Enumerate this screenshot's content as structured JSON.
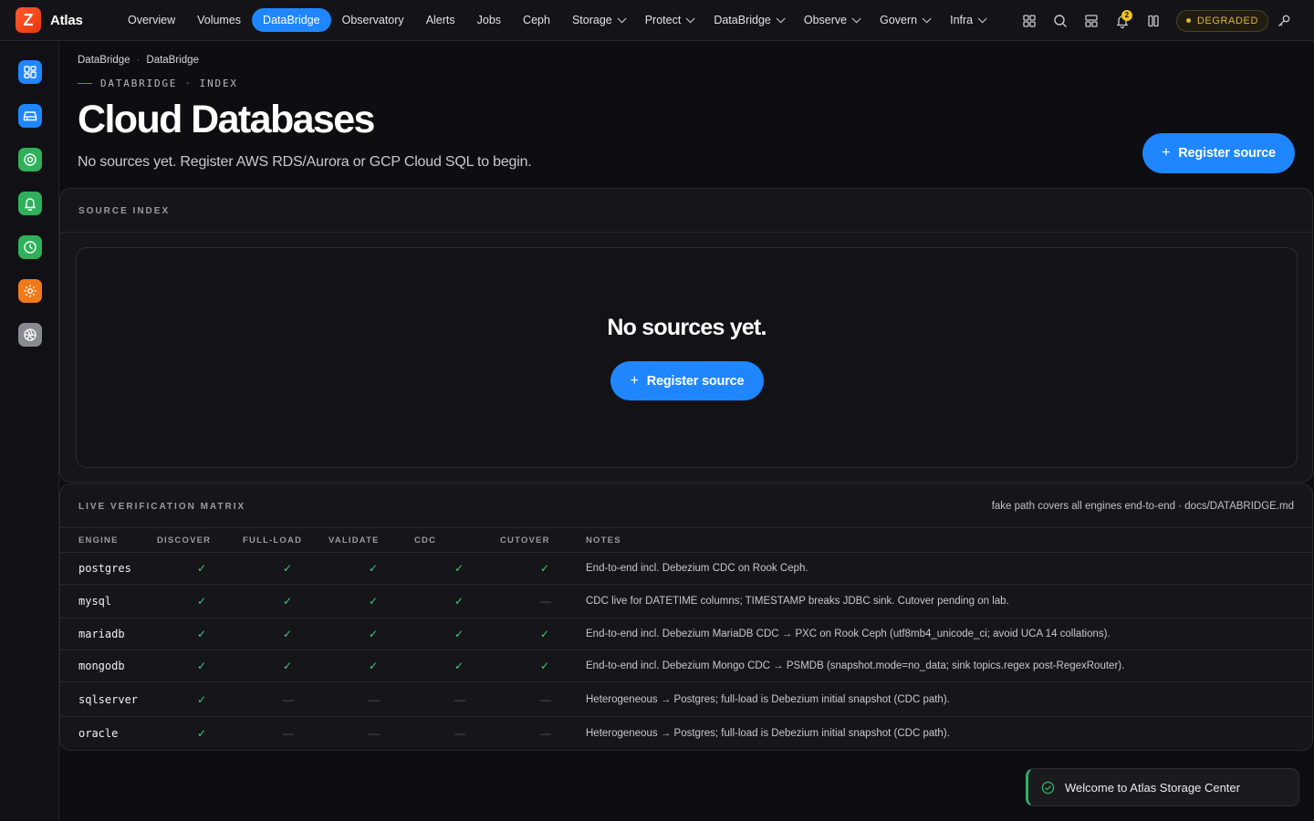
{
  "app": {
    "logo_letter": "Z",
    "name": "Atlas"
  },
  "nav": [
    {
      "label": "Overview",
      "dropdown": false,
      "active": false
    },
    {
      "label": "Volumes",
      "dropdown": false,
      "active": false
    },
    {
      "label": "DataBridge",
      "dropdown": false,
      "active": true
    },
    {
      "label": "Observatory",
      "dropdown": false,
      "active": false
    },
    {
      "label": "Alerts",
      "dropdown": false,
      "active": false
    },
    {
      "label": "Jobs",
      "dropdown": false,
      "active": false
    },
    {
      "label": "Ceph",
      "dropdown": false,
      "active": false
    },
    {
      "label": "Storage",
      "dropdown": true,
      "active": false
    },
    {
      "label": "Protect",
      "dropdown": true,
      "active": false
    },
    {
      "label": "DataBridge",
      "dropdown": true,
      "active": false
    },
    {
      "label": "Observe",
      "dropdown": true,
      "active": false
    },
    {
      "label": "Govern",
      "dropdown": true,
      "active": false
    },
    {
      "label": "Infra",
      "dropdown": true,
      "active": false
    }
  ],
  "toolbar": {
    "icons": [
      "apps-grid-icon",
      "search-icon",
      "layout-icon",
      "bell-icon",
      "columns-icon",
      "key-icon"
    ],
    "notification_count": "2",
    "status_label": "DEGRADED",
    "status_color": "#e0b23a"
  },
  "sidebar": {
    "icons": [
      {
        "name": "dashboard-icon",
        "color": "#1f86ff"
      },
      {
        "name": "storage-drive-icon",
        "color": "#1f86ff"
      },
      {
        "name": "target-icon",
        "color": "#2fb05a"
      },
      {
        "name": "bell-icon",
        "color": "#2fb05a"
      },
      {
        "name": "clock-icon",
        "color": "#2fb05a"
      },
      {
        "name": "settings-gear-icon",
        "color": "#f07a1a"
      },
      {
        "name": "aperture-icon",
        "color": "#8a8a92"
      }
    ]
  },
  "breadcrumb": [
    "DataBridge",
    "DataBridge"
  ],
  "header": {
    "kicker": [
      "DATABRIDGE",
      "INDEX"
    ],
    "title": "Cloud Databases",
    "subtitle": "No sources yet. Register AWS RDS/Aurora or GCP Cloud SQL to begin.",
    "register_label": "Register source"
  },
  "source_index": {
    "label": "SOURCE INDEX",
    "empty_title": "No sources yet.",
    "register_label": "Register source"
  },
  "matrix": {
    "label": "LIVE VERIFICATION MATRIX",
    "note": "fake path covers all engines end-to-end · docs/DATABRIDGE.md",
    "columns": [
      "ENGINE",
      "DISCOVER",
      "FULL-LOAD",
      "VALIDATE",
      "CDC",
      "CUTOVER",
      "NOTES"
    ],
    "rows": [
      {
        "engine": "postgres",
        "flags": [
          true,
          true,
          true,
          true,
          true
        ],
        "notes": "End-to-end incl. Debezium CDC on Rook Ceph."
      },
      {
        "engine": "mysql",
        "flags": [
          true,
          true,
          true,
          true,
          false
        ],
        "notes": "CDC live for DATETIME columns; TIMESTAMP breaks JDBC sink. Cutover pending on lab."
      },
      {
        "engine": "mariadb",
        "flags": [
          true,
          true,
          true,
          true,
          true
        ],
        "notes": "End-to-end incl. Debezium MariaDB CDC → PXC on Rook Ceph (utf8mb4_unicode_ci; avoid UCA 14 collations)."
      },
      {
        "engine": "mongodb",
        "flags": [
          true,
          true,
          true,
          true,
          true
        ],
        "notes": "End-to-end incl. Debezium Mongo CDC → PSMDB (snapshot.mode=no_data; sink topics.regex post-RegexRouter)."
      },
      {
        "engine": "sqlserver",
        "flags": [
          true,
          false,
          false,
          false,
          false
        ],
        "notes": "Heterogeneous → Postgres; full-load is Debezium initial snapshot (CDC path)."
      },
      {
        "engine": "oracle",
        "flags": [
          true,
          false,
          false,
          false,
          false
        ],
        "notes": "Heterogeneous → Postgres; full-load is Debezium initial snapshot (CDC path)."
      }
    ]
  },
  "toast": {
    "text": "Welcome to Atlas Storage Center"
  }
}
